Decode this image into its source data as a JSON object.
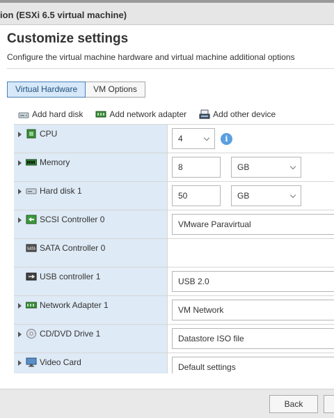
{
  "window": {
    "title": "ion (ESXi 6.5 virtual machine)"
  },
  "page": {
    "title": "Customize settings",
    "description": "Configure the virtual machine hardware and virtual machine additional options"
  },
  "tabs": [
    {
      "label": "Virtual Hardware",
      "active": true
    },
    {
      "label": "VM Options",
      "active": false
    }
  ],
  "toolbar": {
    "add_hard_disk": "Add hard disk",
    "add_network_adapter": "Add network adapter",
    "add_other_device": "Add other device"
  },
  "devices": [
    {
      "label": "CPU",
      "icon": "cpu-icon",
      "expandable": true,
      "value": "4",
      "kind": "select",
      "info": true
    },
    {
      "label": "Memory",
      "icon": "memory-icon",
      "expandable": true,
      "value": "8",
      "unit": "GB",
      "kind": "input-unit"
    },
    {
      "label": "Hard disk 1",
      "icon": "hard-disk-icon",
      "expandable": true,
      "value": "50",
      "unit": "GB",
      "kind": "input-unit"
    },
    {
      "label": "SCSI Controller 0",
      "icon": "scsi-controller-icon",
      "expandable": true,
      "value": "VMware Paravirtual",
      "kind": "select"
    },
    {
      "label": "SATA Controller 0",
      "icon": "sata-controller-icon",
      "expandable": false,
      "value": "",
      "kind": "none"
    },
    {
      "label": "USB controller 1",
      "icon": "usb-controller-icon",
      "expandable": false,
      "value": "USB 2.0",
      "kind": "select"
    },
    {
      "label": "Network Adapter 1",
      "icon": "network-adapter-icon",
      "expandable": true,
      "value": "VM Network",
      "kind": "select"
    },
    {
      "label": "CD/DVD Drive 1",
      "icon": "cd-dvd-icon",
      "expandable": true,
      "value": "Datastore ISO file",
      "kind": "select"
    },
    {
      "label": "Video Card",
      "icon": "video-card-icon",
      "expandable": true,
      "value": "Default settings",
      "kind": "select"
    }
  ],
  "footer": {
    "back_label": "Back"
  },
  "colors": {
    "accent": "#4a7fb6",
    "row_label_bg": "#deeaf5",
    "info": "#5a9fe0"
  }
}
